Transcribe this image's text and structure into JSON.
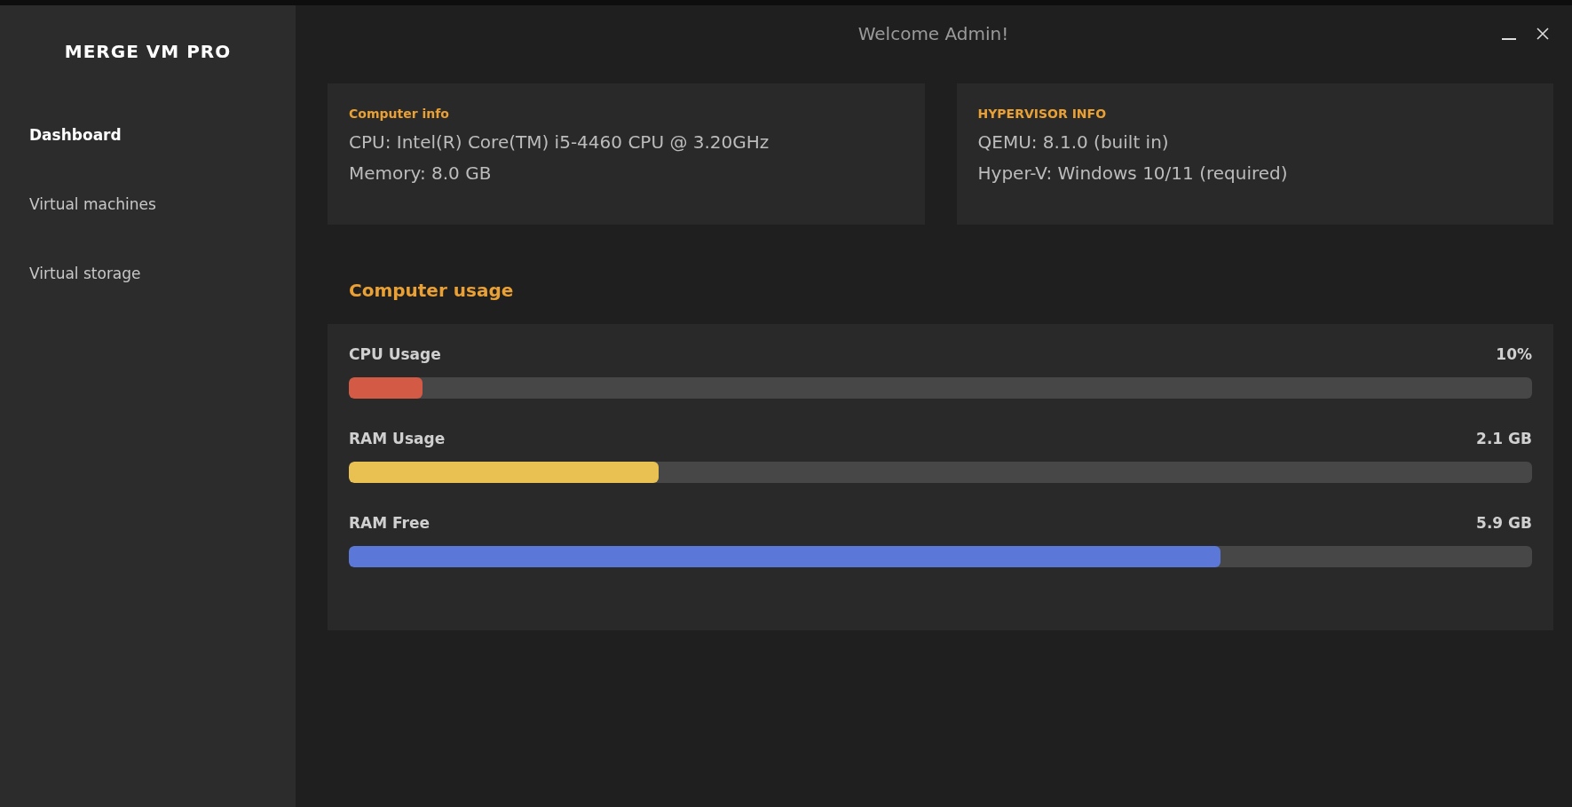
{
  "app_title": "MERGE VM PRO",
  "sidebar": {
    "items": [
      {
        "label": "Dashboard",
        "selected": true
      },
      {
        "label": "Virtual machines",
        "selected": false
      },
      {
        "label": "Virtual storage",
        "selected": false
      }
    ]
  },
  "window": {
    "title": "Welcome Admin!"
  },
  "info_cards": [
    {
      "heading": "Computer info",
      "lines": [
        "CPU: Intel(R) Core(TM) i5-4460 CPU @ 3.20GHz",
        "Memory: 8.0 GB"
      ]
    },
    {
      "heading": "HYPERVISOR INFO",
      "lines": [
        "QEMU: 8.1.0 (built in)",
        "Hyper-V: Windows 10/11 (required)"
      ]
    }
  ],
  "usage": {
    "title": "Computer usage",
    "meters": [
      {
        "name": "CPU Usage",
        "reading": "10%",
        "level": 0.062,
        "color": "#d35a44"
      },
      {
        "name": "RAM Usage",
        "reading": "2.1 GB",
        "level": 0.262,
        "color": "#e8c152"
      },
      {
        "name": "RAM Free",
        "reading": "5.9 GB",
        "level": 0.737,
        "color": "#5b78d8"
      }
    ]
  }
}
